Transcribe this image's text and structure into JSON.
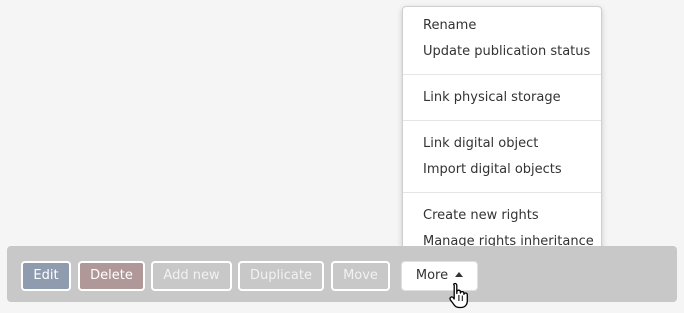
{
  "menu": {
    "groups": [
      [
        "Rename",
        "Update publication status"
      ],
      [
        "Link physical storage"
      ],
      [
        "Link digital object",
        "Import digital objects"
      ],
      [
        "Create new rights",
        "Manage rights inheritance"
      ]
    ]
  },
  "actions": {
    "edit": "Edit",
    "delete": "Delete",
    "add_new": "Add new",
    "duplicate": "Duplicate",
    "move": "Move",
    "more": "More"
  },
  "icons": {
    "more_caret": "caret-up-icon",
    "cursor": "hand-pointer-cursor-icon"
  }
}
